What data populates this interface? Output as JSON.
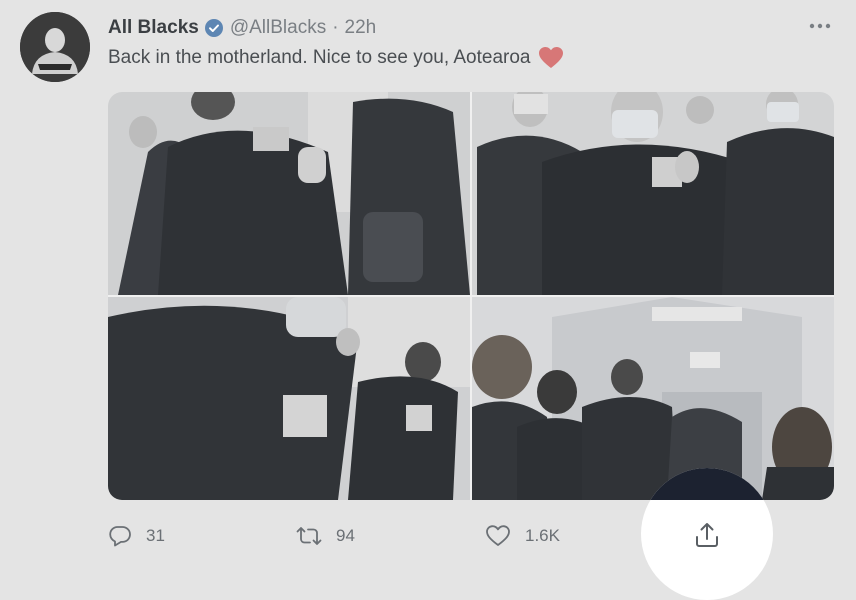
{
  "tweet": {
    "author_name": "All Blacks",
    "handle": "@AllBlacks",
    "separator": "·",
    "time": "22h",
    "text": "Back in the motherland. Nice to see you, Aotearoa",
    "emoji_icon": "red-heart-icon"
  },
  "media": {
    "photos": [
      {
        "name": "photo-1",
        "scene": "players in masks walking"
      },
      {
        "name": "photo-2",
        "scene": "player giving peace sign"
      },
      {
        "name": "photo-3",
        "scene": "players in airport corridor"
      },
      {
        "name": "photo-4",
        "scene": "players walking through exit"
      }
    ]
  },
  "actions": {
    "reply_count": "31",
    "retweet_count": "94",
    "like_count": "1.6K",
    "icons": [
      "reply-icon",
      "retweet-icon",
      "like-icon",
      "share-icon"
    ]
  },
  "colors": {
    "background": "#e4e4e4",
    "verified": "#5d86b3",
    "heart": "#d77777",
    "share_highlight": "#ffffff"
  }
}
